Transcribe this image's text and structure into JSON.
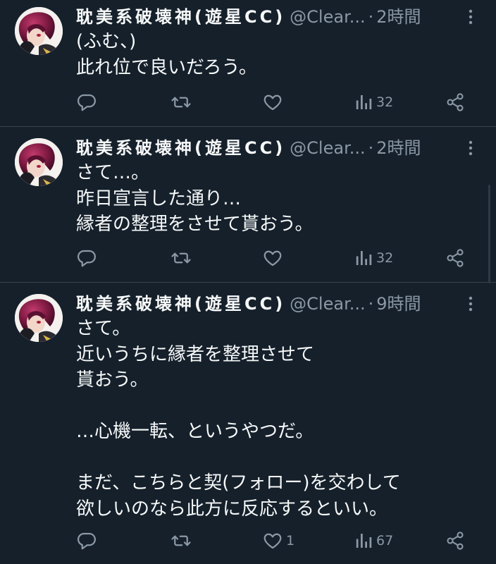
{
  "tweets": [
    {
      "display_name": "耽美系破壊神(遊星CC)",
      "handle": "@Clear...",
      "separator": "·",
      "time": "2時間",
      "text": "(ふむ、)\n此れ位で良いだろう。",
      "actions": {
        "replies": "",
        "retweets": "",
        "likes": "",
        "views": "32"
      }
    },
    {
      "display_name": "耽美系破壊神(遊星CC)",
      "handle": "@Clear...",
      "separator": "·",
      "time": "2時間",
      "text": "さて…。\n昨日宣言した通り…\n縁者の整理をさせて貰おう。",
      "actions": {
        "replies": "",
        "retweets": "",
        "likes": "",
        "views": "32"
      }
    },
    {
      "display_name": "耽美系破壊神(遊星CC)",
      "handle": "@Clear...",
      "separator": "·",
      "time": "9時間",
      "text": "さて。\n近いうちに縁者を整理させて\n貰おう。\n\n…心機一転、というやつだ。\n\nまだ、こちらと契(フォロー)を交わして\n欲しいのなら此方に反応するといい。",
      "actions": {
        "replies": "",
        "retweets": "",
        "likes": "1",
        "views": "67"
      }
    }
  ],
  "icons": {
    "reply": "reply-icon",
    "retweet": "retweet-icon",
    "like": "heart-icon",
    "views": "views-icon",
    "share": "share-icon",
    "more": "more-icon"
  },
  "colors": {
    "background": "#15202b",
    "text_primary": "#f7f9f9",
    "text_secondary": "#8b98a5",
    "divider": "#38444d"
  }
}
